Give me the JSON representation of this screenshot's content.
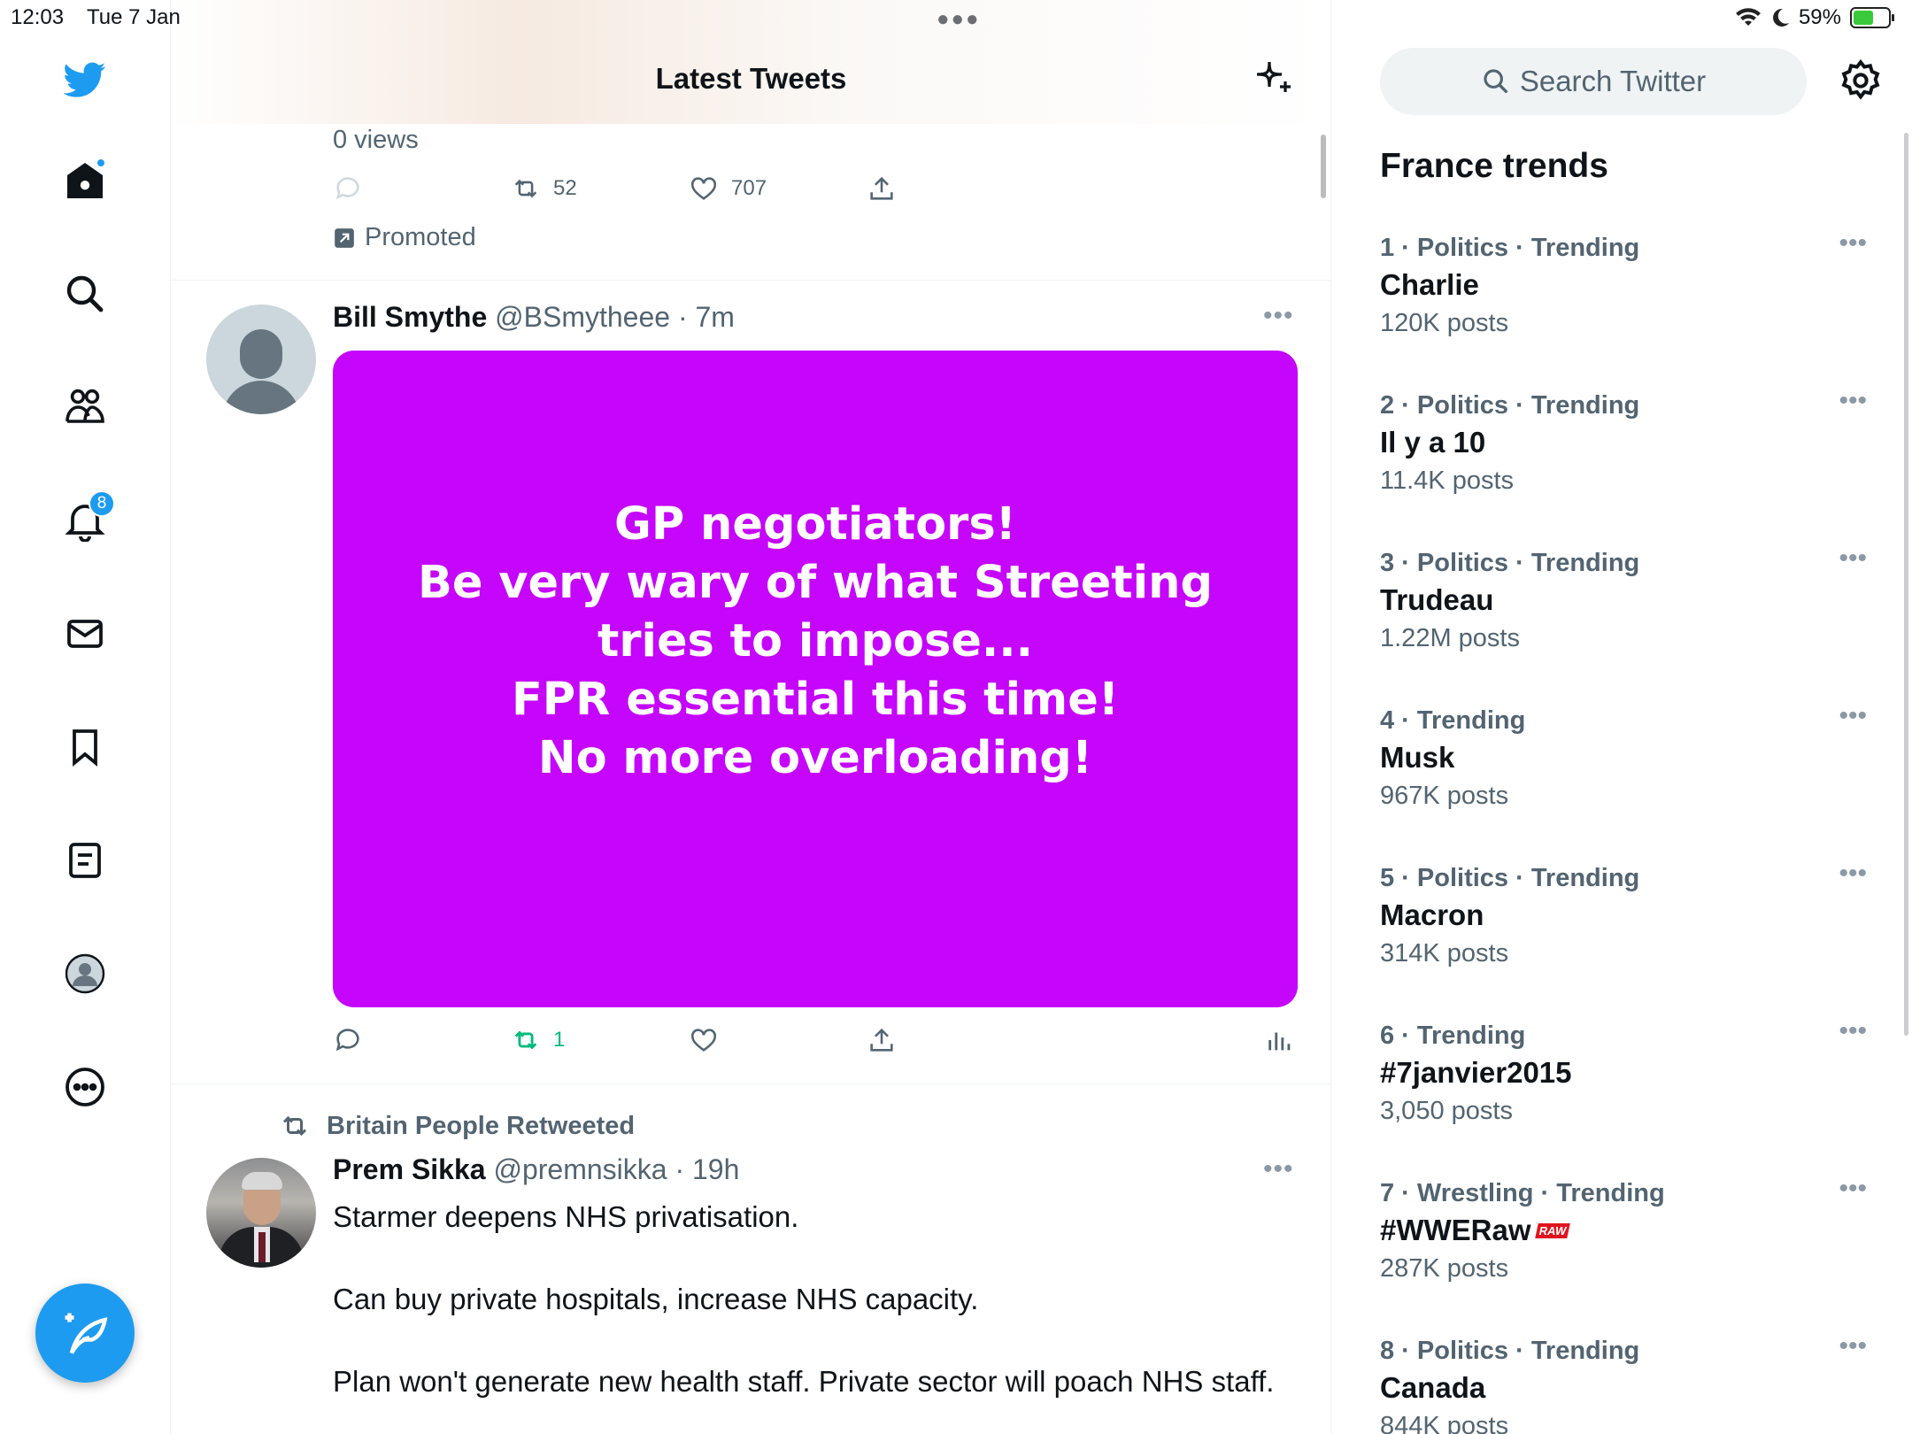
{
  "status_bar": {
    "time": "12:03",
    "date": "Tue 7 Jan",
    "battery": "59%",
    "battery_level": 0.59
  },
  "nav": {
    "items": [
      "home-icon",
      "search-icon",
      "communities-icon",
      "notifications-icon",
      "messages-icon",
      "bookmarks-icon",
      "lists-icon",
      "profile-icon",
      "more-icon"
    ],
    "notifications_badge": "8",
    "accent_color": "#1d9bf0"
  },
  "feed": {
    "title": "Latest Tweets",
    "promoted_tweet": {
      "views": "0 views",
      "retweets": "52",
      "likes": "707",
      "promoted_label": "Promoted"
    },
    "tweet1": {
      "name": "Bill Smythe",
      "handle": "@BSmytheee",
      "time": "· 7m",
      "media_lines": [
        "GP negotiators!",
        "Be very wary of what Streeting",
        "tries to impose...",
        "FPR essential this time!",
        "No more overloading!"
      ],
      "media_color": "#c505fc",
      "retweets": "1"
    },
    "tweet2": {
      "retweeted_by": "Britain People Retweeted",
      "name": "Prem Sikka",
      "handle": "@premnsikka",
      "time": "· 19h",
      "paragraphs": [
        "Starmer deepens NHS privatisation.",
        "Can buy private hospitals, increase NHS capacity.",
        "Plan won't generate new health staff. Private sector will poach NHS staff."
      ]
    }
  },
  "right": {
    "search_placeholder": "Search Twitter",
    "trends_title": "France trends",
    "trends": [
      {
        "context": "1 · Politics · Trending",
        "name": "Charlie",
        "posts": "120K posts"
      },
      {
        "context": "2 · Politics · Trending",
        "name": "Il y a 10",
        "posts": "11.4K posts"
      },
      {
        "context": "3 · Politics · Trending",
        "name": "Trudeau",
        "posts": "1.22M posts"
      },
      {
        "context": "4 · Trending",
        "name": "Musk",
        "posts": "967K posts"
      },
      {
        "context": "5 · Politics · Trending",
        "name": "Macron",
        "posts": "314K posts"
      },
      {
        "context": "6 · Trending",
        "name": "#7janvier2015",
        "posts": "3,050 posts"
      },
      {
        "context": "7 · Wrestling · Trending",
        "name": "#WWERaw",
        "posts": "287K posts",
        "logo": "RAW"
      },
      {
        "context": "8 · Politics · Trending",
        "name": "Canada",
        "posts": "844K posts"
      }
    ]
  }
}
